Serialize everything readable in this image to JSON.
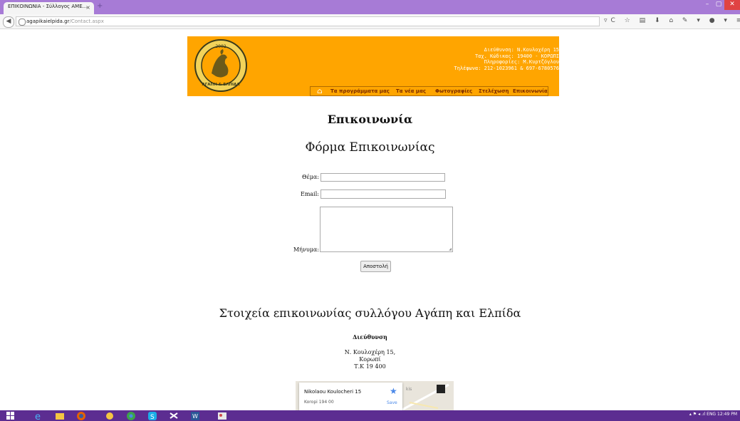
{
  "browser": {
    "tab_title": "ΕΠΙΚΟΙΝΩΝΙΑ - Σύλλογος ΑΜΕ...",
    "tab_close": "×",
    "new_tab": "+",
    "url_host": "agapikaielpida.gr",
    "url_path": "/Contact.aspx",
    "nav_icons": "▿C ☆ ▤ ⬇ ⌂ ✎ ▾ ● ▾ ≡"
  },
  "header": {
    "address": "Διεύθυνση: Ν.Κουλοχέρη 15",
    "postal": "Ταχ. Κώδικας: 19400 - ΚΟΡΩΠΙ",
    "info": "Πληροφορίες: Μ.Κυρτζόγλου",
    "phones": "Τηλέφωνα: 212-1023961 & 697-6780576",
    "logo_text_top": "2002",
    "logo_text_bottom": "ΑΓΑΠΗ & ΕΛΠΙΔΑ"
  },
  "menu": {
    "home_icon": "home-icon",
    "items": [
      "Τα προγράμματα μας",
      "Τα νέα μας",
      "Φωτογραφίες",
      "Στελέχωση",
      "Επικοινωνία"
    ]
  },
  "page": {
    "title": "Επικοινωνία",
    "form_title": "Φόρμα Επικοινωνίας",
    "subject_label": "Θέμα:",
    "email_label": "Email:",
    "message_label": "Μήνυμα:",
    "submit_label": "Αποστολή",
    "contact_title": "Στοιχεία επικοινωνίας συλλόγου Αγάπη και Ελπίδα",
    "address_heading": "Διεύθυνση",
    "address_line1": "Ν. Κουλοχέρη 15,",
    "address_line2": "Κορωπί",
    "address_line3": "Τ.Κ 19 400"
  },
  "map": {
    "place": "Nikolaou Koulocheri 15",
    "area": "Koropi 194 00",
    "save": "Save",
    "fragment": "kis"
  },
  "taskbar": {
    "tray": "▴ ⚑ ◂ .ıl ENG",
    "time": "12:49 PM"
  }
}
